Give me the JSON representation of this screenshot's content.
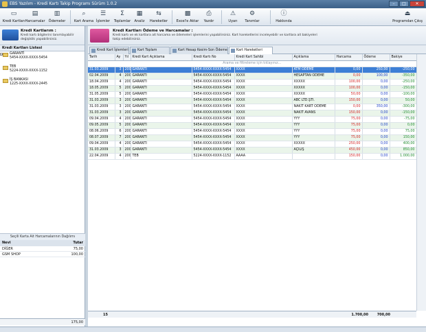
{
  "window": {
    "title": "EBS Yazılım - Kredi Kartı Takip Programı Sürüm 1.0.2"
  },
  "toolbar": [
    {
      "label": "Kredi Kartları",
      "icon": "credit-card-icon"
    },
    {
      "label": "Harcamalar",
      "icon": "spending-icon"
    },
    {
      "label": "Ödemeler",
      "icon": "payment-icon"
    },
    {
      "label": "Kart Arama",
      "icon": "search-icon"
    },
    {
      "label": "İşlemler",
      "icon": "transactions-icon"
    },
    {
      "label": "Toplamlar",
      "icon": "sigma-icon"
    },
    {
      "label": "Analiz",
      "icon": "analysis-icon"
    },
    {
      "label": "Hareketler",
      "icon": "movements-icon"
    },
    {
      "label": "Excel'e Aktar",
      "icon": "excel-icon"
    },
    {
      "label": "Yazdır",
      "icon": "printer-icon"
    },
    {
      "label": "Uyarı",
      "icon": "warning-icon"
    },
    {
      "label": "Tanımlar",
      "icon": "definitions-icon"
    },
    {
      "label": "Hakkında",
      "icon": "info-icon"
    },
    {
      "label": "Programdan Çıkış",
      "icon": "exit-icon"
    }
  ],
  "left": {
    "title": "Kredi Kartlarım :",
    "desc": "Kredi kartı bilgilerini tanımlayabilir değişiklik yapabilirsiniz.",
    "list_header": "Kredi Kartları Listesi",
    "cards": [
      {
        "bank": "GARANTİ",
        "number": "5454-XXXX-XXXX-5454"
      },
      {
        "bank": "TEB",
        "number": "5224-XXXX-XXXX-1152"
      },
      {
        "bank": "İŞ BANKASI",
        "number": "1225-XXXX-XXXX-2445"
      }
    ],
    "summary_title": "Seçili Karta Ait Harcamalarının Dağılımı",
    "summary_headers": {
      "col1": "Nevi",
      "col2": "Tutar"
    },
    "summary_rows": [
      {
        "nevi": "DİĞER",
        "tutar": "75,00"
      },
      {
        "nevi": "GSM SHOP",
        "tutar": "100,00"
      }
    ],
    "summary_total": "175,00"
  },
  "main": {
    "title": "Kredi Kartları Ödeme ve Harcamalar :",
    "desc": "Kredi kartı ve ek kartlara ait harcama ve ödemeleri işlemlerini yapabilirsiniz. Kart hareketlerini inceleyebilir ve kartlara ait bakiyeleri takip edebilirsiniz.",
    "tabs": [
      "Kredi Kart İşlemleri",
      "Kart Toplam Raporu",
      "Kart Hesap Kesim-Son Ödeme",
      "Kart Hareketleri Tümü"
    ],
    "columns": [
      "Tarih",
      "Ay",
      "Yıl",
      "Kredi Kart Açıklama",
      "Kredi Kartı No",
      "Kredi Kart Sahibi",
      "Açıklama",
      "Harcama",
      "Ödeme",
      "Bakiye"
    ],
    "filter_text": "Arama ve filtreleme için tıklayınız...",
    "rows": [
      {
        "tarih": "31.03.2009",
        "ay": "3",
        "yil": "2009",
        "kk": "GARANTİ",
        "no": "5454-XXXX-XXXX-5454",
        "sahip": "XXXX",
        "acik": "ATM ÖDEME",
        "harcama": "0,00",
        "odeme": "250,00",
        "bakiye": "-250,00"
      },
      {
        "tarih": "02.04.2009",
        "ay": "4",
        "yil": "2009",
        "kk": "GARANTİ",
        "no": "5454-XXXX-XXXX-5454",
        "sahip": "XXXX",
        "acik": "HESAPTAN ÖDEME",
        "harcama": "0,00",
        "odeme": "100,00",
        "bakiye": "-350,00"
      },
      {
        "tarih": "18.04.2009",
        "ay": "4",
        "yil": "2009",
        "kk": "GARANTİ",
        "no": "5454-XXXX-XXXX-5454",
        "sahip": "XXXX",
        "acik": "XXXXX",
        "harcama": "100,00",
        "odeme": "0,00",
        "bakiye": "-250,00"
      },
      {
        "tarih": "18.05.2009",
        "ay": "5",
        "yil": "2009",
        "kk": "GARANTİ",
        "no": "5454-XXXX-XXXX-5454",
        "sahip": "XXXX",
        "acik": "XXXXX",
        "harcama": "100,00",
        "odeme": "0,00",
        "bakiye": "-150,00"
      },
      {
        "tarih": "31.05.2009",
        "ay": "5",
        "yil": "2009",
        "kk": "GARANTİ",
        "no": "5454-XXXX-XXXX-5454",
        "sahip": "XXXX",
        "acik": "XXXXX",
        "harcama": "50,00",
        "odeme": "0,00",
        "bakiye": "-100,00"
      },
      {
        "tarih": "31.03.2009",
        "ay": "3",
        "yil": "2009",
        "kk": "GARANTİ",
        "no": "5454-XXXX-XXXX-5454",
        "sahip": "XXXX",
        "acik": "ABC LTD.ŞTİ.",
        "harcama": "150,00",
        "odeme": "0,00",
        "bakiye": "50,00"
      },
      {
        "tarih": "31.03.2009",
        "ay": "3",
        "yil": "2009",
        "kk": "GARANTİ",
        "no": "5454-XXXX-XXXX-5454",
        "sahip": "XXXX",
        "acik": "NAKİT KART ÖDEME",
        "harcama": "0,00",
        "odeme": "350,00",
        "bakiye": "-300,00"
      },
      {
        "tarih": "31.03.2009",
        "ay": "3",
        "yil": "2009",
        "kk": "GARANTİ",
        "no": "5454-XXXX-XXXX-5454",
        "sahip": "XXXX",
        "acik": "NAKİT AVANS",
        "harcama": "150,00",
        "odeme": "0,00",
        "bakiye": "-150,00"
      },
      {
        "tarih": "09.04.2009",
        "ay": "4",
        "yil": "2009",
        "kk": "GARANTİ",
        "no": "5454-XXXX-XXXX-5454",
        "sahip": "XXXX",
        "acik": "YYY",
        "harcama": "75,00",
        "odeme": "0,00",
        "bakiye": "-75,00"
      },
      {
        "tarih": "09.05.2009",
        "ay": "5",
        "yil": "2009",
        "kk": "GARANTİ",
        "no": "5454-XXXX-XXXX-5454",
        "sahip": "XXXX",
        "acik": "YYY",
        "harcama": "75,00",
        "odeme": "0,00",
        "bakiye": "0,00"
      },
      {
        "tarih": "08.06.2009",
        "ay": "6",
        "yil": "2009",
        "kk": "GARANTİ",
        "no": "5454-XXXX-XXXX-5454",
        "sahip": "XXXX",
        "acik": "YYY",
        "harcama": "75,00",
        "odeme": "0,00",
        "bakiye": "75,00"
      },
      {
        "tarih": "08.07.2009",
        "ay": "7",
        "yil": "2009",
        "kk": "GARANTİ",
        "no": "5454-XXXX-XXXX-5454",
        "sahip": "XXXX",
        "acik": "YYY",
        "harcama": "75,00",
        "odeme": "0,00",
        "bakiye": "150,00"
      },
      {
        "tarih": "09.04.2009",
        "ay": "4",
        "yil": "2009",
        "kk": "GARANTİ",
        "no": "5454-XXXX-XXXX-5454",
        "sahip": "XXXX",
        "acik": "XXXXX",
        "harcama": "250,00",
        "odeme": "0,00",
        "bakiye": "400,00"
      },
      {
        "tarih": "31.03.2009",
        "ay": "3",
        "yil": "2009",
        "kk": "GARANTİ",
        "no": "5454-XXXX-XXXX-5454",
        "sahip": "XXXX",
        "acik": "AÇILIŞ",
        "harcama": "450,00",
        "odeme": "0,00",
        "bakiye": "850,00"
      },
      {
        "tarih": "22.04.2009",
        "ay": "4",
        "yil": "2009",
        "kk": "TEB",
        "no": "5224-XXXX-XXXX-1152",
        "sahip": "AAAA",
        "acik": "",
        "harcama": "150,00",
        "odeme": "0,00",
        "bakiye": "1.000,00"
      }
    ],
    "footer": {
      "count": "15",
      "harcama_total": "1.700,00",
      "odeme_total": "700,00"
    }
  }
}
